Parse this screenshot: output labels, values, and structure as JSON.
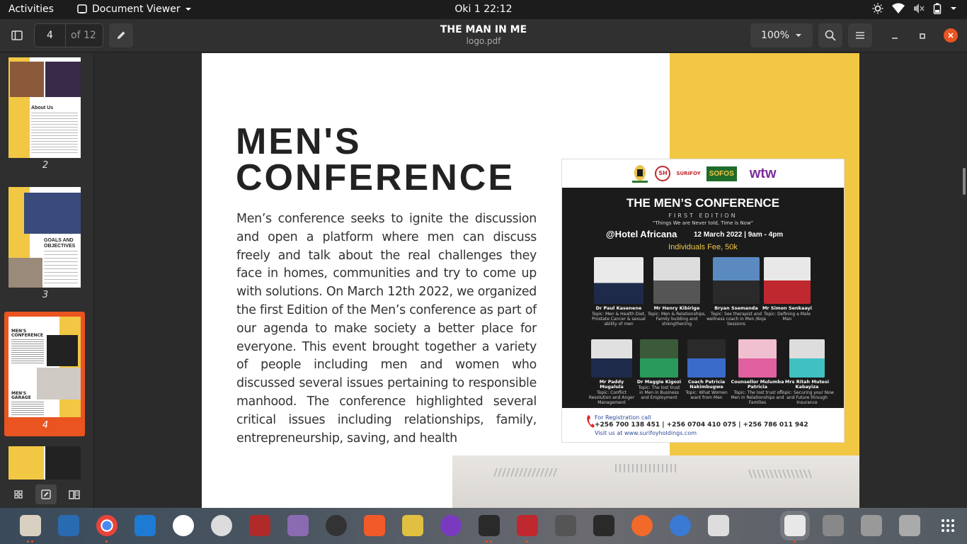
{
  "topbar": {
    "activities": "Activities",
    "app_name": "Document Viewer",
    "clock": "Oki 1  22:12"
  },
  "header": {
    "page_current": "4",
    "page_total": "of 12",
    "title": "THE MAN IN ME",
    "filename": "logo.pdf",
    "zoom": "100%"
  },
  "sidebar": {
    "thumbnails": [
      {
        "label": "2",
        "heading": "About Us"
      },
      {
        "label": "3",
        "heading": "GOALS AND OBJECTIVES"
      },
      {
        "label": "4",
        "heading": "MEN'S CONFERENCE",
        "heading2": "MEN'S GARAGE"
      }
    ]
  },
  "document": {
    "heading": "MEN'S CONFERENCE",
    "body": "Men’s conference seeks to ignite the discussion and open a platform where men can discuss freely and talk about the real challenges they face in homes, communities and try to come up with solutions. On March 12th 2022, we organized the first Edition of the Men’s conference as part of our agenda to make society a better place for everyone. This event brought together a variety of people including men and women who discussed several issues pertaining to responsible manhood. The conference highlighted several critical issues including relationships, family, entrepreneurship, saving, and health",
    "poster": {
      "logos": [
        "SURIFOY",
        "SOFOS",
        "wtw"
      ],
      "title": "THE MEN’S CONFERENCE",
      "edition": "FIRST EDITION",
      "tagline": "“Things We are Never told, Time is Now”",
      "venue": "@Hotel Africana",
      "date": "12 March 2022 | 9am - 4pm",
      "fee": "Individuals Fee, 50k",
      "speakers_row1": [
        {
          "name": "Dr Paul Kasenene",
          "topic": "Topic: Men & Health Diet, Prostate Cancer & sexual ability of men"
        },
        {
          "name": "Mr Henry Kibirige",
          "topic": "Topic: Men & Relationships, Family building and strengthening"
        },
        {
          "name": "Bryan Ssemanda",
          "topic": "Topic: Sex therapist and wellness coach in Men /Koja Sessions"
        },
        {
          "name": "Mr Simon Senkaayi",
          "topic": "Topic: Defining a Male Man"
        }
      ],
      "speakers_row2": [
        {
          "name": "Mr Paddy Mugalula",
          "topic": "Topic: Conflict Resolution and Anger Management"
        },
        {
          "name": "Dr Maggie Kigozi",
          "topic": "Topic: The lost trust in Men in Business and Employment"
        },
        {
          "name": "Coach Patricia Nakimbugwe",
          "topic": "Topic: What Women want from Men"
        },
        {
          "name": "Counsellor Mulumba Patricia",
          "topic": "Topic: The lost trust of Men in Relationships and Families"
        },
        {
          "name": "Mrs Ritah Mutesi Kabayiza",
          "topic": "Topic: Securing your Now and Future through Insurance"
        }
      ],
      "registration": "For Registration call",
      "phones": "+256 700 138 451 | +256 0704 410 075 | +256 786 011 942",
      "website": "Visit us at www.surifoyholdings.com"
    }
  },
  "dock": {
    "apps": [
      "files-icon",
      "writer-icon",
      "chrome-icon",
      "vscode-icon",
      "app-icon",
      "settings-icon",
      "screen-icon",
      "video-icon",
      "wine-icon",
      "brave-icon",
      "calculator-icon",
      "podcast-icon",
      "terminal-icon",
      "filezilla-icon",
      "texmaker-icon",
      "monitor-icon",
      "pen-icon",
      "thunderbird-icon",
      "search-icon",
      "document-viewer-icon",
      "usb-icon",
      "ssd-icon",
      "drive-icon",
      "grid-icon"
    ]
  },
  "colors": {
    "accent": "#e95420",
    "yellow": "#f2c744",
    "poster_dark": "#1b1b1b"
  }
}
